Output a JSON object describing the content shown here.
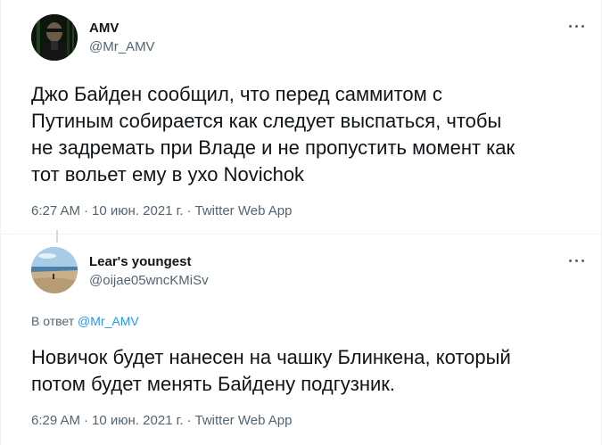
{
  "tweets": [
    {
      "author_name": "AMV",
      "author_handle": "@Mr_AMV",
      "text": "Джо Байден сообщил, что перед саммитом с\nПутиным собирается как следует выспаться, чтобы\nне задремать при Владе и не пропустить момент как\nтот вольет ему в ухо Novichok",
      "time": "6:27 AM",
      "date": "10 июн. 2021 г.",
      "source": "Twitter Web App",
      "separator": "·",
      "more_icon": "more-horizontal-icon"
    },
    {
      "author_name": "Lear's youngest",
      "author_handle": "@oijae05wncKMiSv",
      "reply_label": "В ответ",
      "reply_mention": "@Mr_AMV",
      "text": "Новичок будет нанесен на чашку Блинкена, который\nпотом будет менять Байдену подгузник.",
      "time": "6:29 AM",
      "date": "10 июн. 2021 г.",
      "source": "Twitter Web App",
      "separator": "·",
      "more_icon": "more-horizontal-icon"
    }
  ],
  "colors": {
    "primary_text": "#0f1419",
    "secondary_text": "#536471",
    "link": "#1d9bf0",
    "divider": "#eff3f4"
  }
}
